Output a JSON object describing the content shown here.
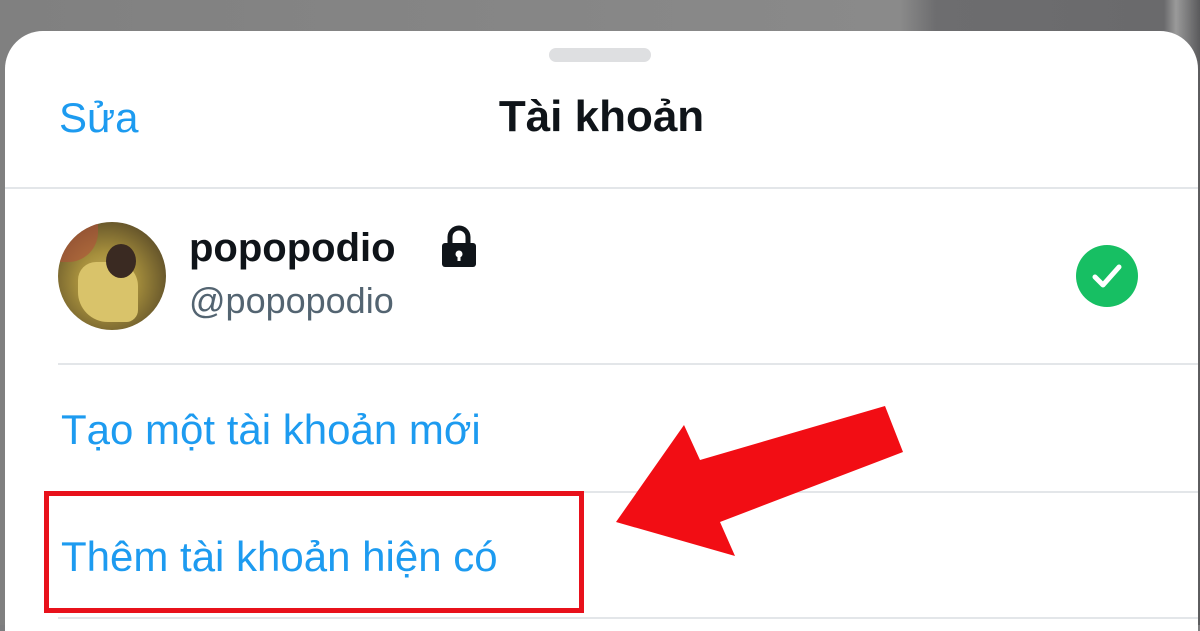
{
  "sheet": {
    "edit_label": "Sửa",
    "title": "Tài khoản"
  },
  "account": {
    "display_name": "popopodio",
    "handle": "@popopodio",
    "protected_icon": "lock-icon",
    "selected_icon": "checkmark-circle-icon"
  },
  "actions": {
    "create_label": "Tạo một tài khoản mới",
    "add_existing_label": "Thêm tài khoản hiện có"
  },
  "colors": {
    "accent": "#1d9bf0",
    "selected": "#17bf63",
    "annotation": "#e8111b"
  }
}
